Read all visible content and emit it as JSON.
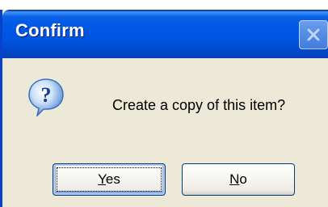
{
  "dialog": {
    "title": "Confirm",
    "message": "Create a copy of this item?",
    "icon": "question-icon"
  },
  "buttons": {
    "yes": {
      "mnemonic": "Y",
      "rest": "es"
    },
    "no": {
      "mnemonic": "N",
      "rest": "o"
    }
  },
  "colors": {
    "titlebar": "#0058e6",
    "face": "#ece9d8",
    "title_text": "#ffffff",
    "default_button_border": "#003c74"
  }
}
